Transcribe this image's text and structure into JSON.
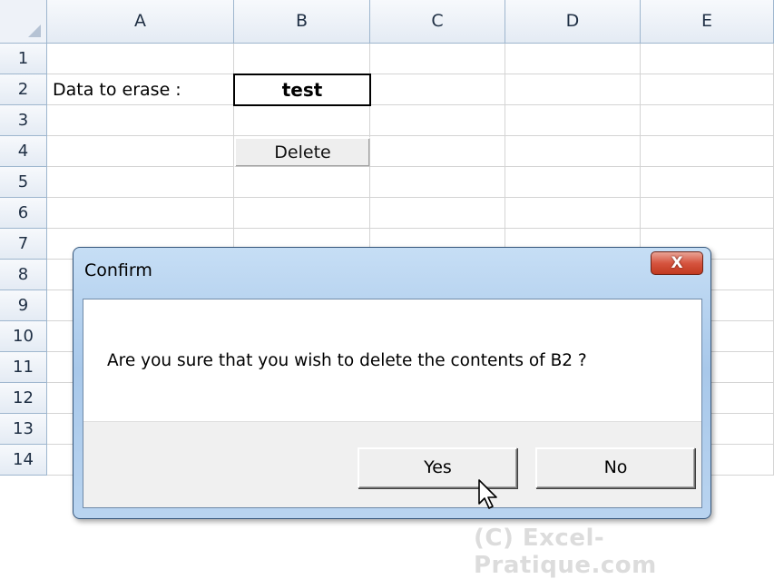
{
  "columns": [
    "A",
    "B",
    "C",
    "D",
    "E"
  ],
  "rows": [
    "1",
    "2",
    "3",
    "4",
    "5",
    "6",
    "7",
    "8",
    "9",
    "10",
    "11",
    "12",
    "13",
    "14"
  ],
  "cells": {
    "A2": "Data to erase :",
    "B2": "test",
    "B4_button": "Delete"
  },
  "dialog": {
    "title": "Confirm",
    "close_label": "X",
    "message": "Are you sure that you wish to delete the contents of B2 ?",
    "yes_label": "Yes",
    "no_label": "No"
  },
  "watermark": "(C) Excel-Pratique.com",
  "colors": {
    "header_bg": "#e4ebf4",
    "grid_line": "#d4d4d4",
    "dialog_frame": "#a8c8ea",
    "close_button": "#c1391f"
  },
  "icons": [
    "select-all-corner-icon",
    "close-icon",
    "mouse-pointer-icon"
  ]
}
